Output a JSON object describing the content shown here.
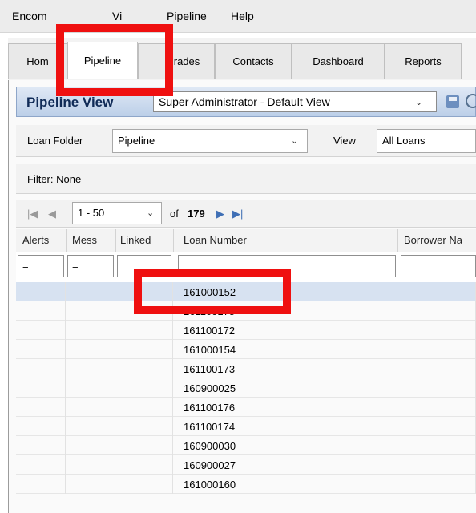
{
  "menu": {
    "encompass": "Encom",
    "view": "Vi",
    "pipeline": "Pipeline",
    "help": "Help"
  },
  "tabs": [
    "Hom",
    "Pipeline",
    "rades",
    "Contacts",
    "Dashboard",
    "Reports"
  ],
  "active_tab": "Pipeline",
  "pipeline_view": {
    "title": "Pipeline View",
    "selected_view": "Super Administrator - Default View"
  },
  "loan_folder": {
    "label": "Loan Folder",
    "value": "Pipeline"
  },
  "view_filter": {
    "label": "View",
    "value": "All Loans"
  },
  "filter_text": "Filter:  None",
  "pager": {
    "range": "1 - 50",
    "of_label": "of",
    "total": "179"
  },
  "columns": [
    "Alerts",
    "Mess",
    "Linked",
    "Loan Number",
    "Borrower Na"
  ],
  "filter_values": {
    "alerts": "=",
    "mess": "="
  },
  "loans": [
    "161000152",
    "161100175",
    "161100172",
    "161000154",
    "161100173",
    "160900025",
    "161100176",
    "161100174",
    "160900030",
    "160900027",
    "161000160"
  ],
  "colors": {
    "highlight": "#ef1010",
    "selected_row": "#d7e2f1",
    "header_bg": "#bccfe8"
  }
}
